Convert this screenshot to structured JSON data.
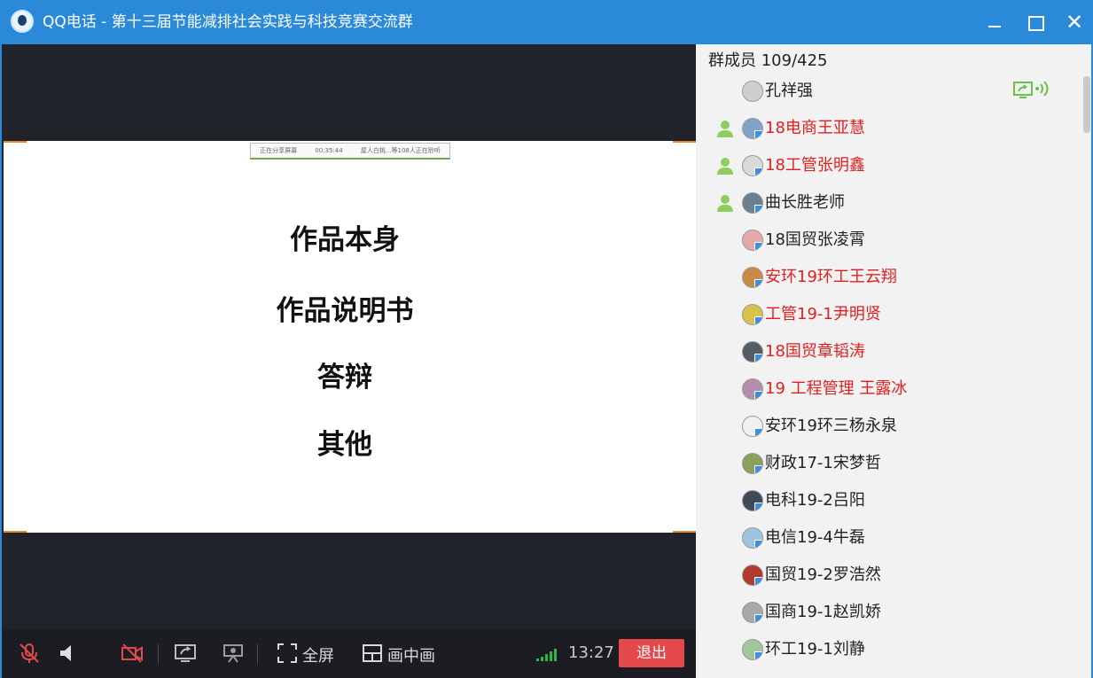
{
  "window": {
    "title": "QQ电话 - 第十三届节能减排社会实践与科技竞赛交流群",
    "icons": [
      "qq-call-logo-icon",
      "minimize-icon",
      "maximize-icon",
      "close-icon"
    ]
  },
  "slide": {
    "banner": [
      "正在分享屏幕",
      "00:35:44",
      "屋人白桃...等108人正在聆听"
    ],
    "items": [
      "作品本身",
      "作品说明书",
      "答辩",
      "其他"
    ]
  },
  "toolbar": {
    "fullscreen_label": "全屏",
    "pip_label": "画中画",
    "time": "13:27",
    "exit_label": "退出",
    "icons": [
      "mic-muted-icon",
      "speaker-icon",
      "camera-off-icon",
      "share-screen-icon",
      "projector-icon",
      "fullscreen-icon",
      "pip-icon",
      "signal-icon"
    ]
  },
  "members": {
    "header": "群成员 109/425",
    "list": [
      {
        "name": "孔祥强",
        "color": "black",
        "mic": false,
        "sharing": true
      },
      {
        "name": "18电商王亚慧",
        "color": "red",
        "mic": true,
        "sharing": false
      },
      {
        "name": "18工管张明鑫",
        "color": "red",
        "mic": true,
        "sharing": false
      },
      {
        "name": "曲长胜老师",
        "color": "black",
        "mic": true,
        "sharing": false
      },
      {
        "name": "18国贸张凌霄",
        "color": "black",
        "mic": false,
        "sharing": false
      },
      {
        "name": "安环19环工王云翔",
        "color": "red",
        "mic": false,
        "sharing": false
      },
      {
        "name": "工管19-1尹明贤",
        "color": "red",
        "mic": false,
        "sharing": false
      },
      {
        "name": "18国贸章韬涛",
        "color": "red",
        "mic": false,
        "sharing": false
      },
      {
        "name": "19 工程管理 王露冰",
        "color": "red",
        "mic": false,
        "sharing": false
      },
      {
        "name": "安环19环三杨永泉",
        "color": "black",
        "mic": false,
        "sharing": false
      },
      {
        "name": "财政17-1宋梦哲",
        "color": "black",
        "mic": false,
        "sharing": false
      },
      {
        "name": "电科19-2吕阳",
        "color": "black",
        "mic": false,
        "sharing": false
      },
      {
        "name": "电信19-4牛磊",
        "color": "black",
        "mic": false,
        "sharing": false
      },
      {
        "name": "国贸19-2罗浩然",
        "color": "black",
        "mic": false,
        "sharing": false
      },
      {
        "name": "国商19-1赵凯娇",
        "color": "black",
        "mic": false,
        "sharing": false
      },
      {
        "name": "环工19-1刘静",
        "color": "black",
        "mic": false,
        "sharing": false
      }
    ]
  },
  "colors": {
    "titlebar": "#2a89d8",
    "exit": "#e3484a",
    "highlight_name": "#e21f1f",
    "signal": "#2db84b",
    "corner": "#e8862c"
  }
}
